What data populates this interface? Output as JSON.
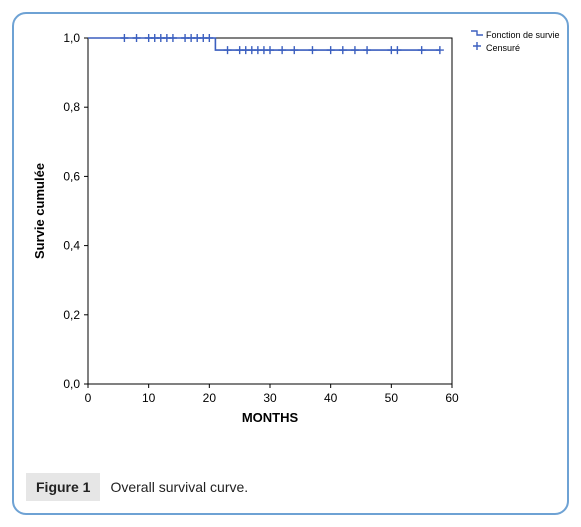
{
  "legend": {
    "series_label": "Fonction de survie",
    "censored_label": "Censuré"
  },
  "figure": {
    "badge": "Figure 1",
    "caption": "Overall survival curve."
  },
  "chart_data": {
    "type": "line",
    "title": "",
    "xlabel": "MONTHS",
    "ylabel": "Survie cumulée",
    "xlim": [
      0,
      60
    ],
    "ylim": [
      0.0,
      1.0
    ],
    "xticks": [
      0,
      10,
      20,
      30,
      40,
      50,
      60
    ],
    "yticks": [
      0.0,
      0.2,
      0.4,
      0.6,
      0.8,
      1.0
    ],
    "series": [
      {
        "name": "Fonction de survie",
        "type": "step",
        "points": [
          {
            "x": 0,
            "y": 1.0
          },
          {
            "x": 21,
            "y": 1.0
          },
          {
            "x": 21,
            "y": 0.965
          },
          {
            "x": 58,
            "y": 0.965
          }
        ],
        "censor_marks": [
          {
            "x": 6,
            "y": 1.0
          },
          {
            "x": 8,
            "y": 1.0
          },
          {
            "x": 10,
            "y": 1.0
          },
          {
            "x": 11,
            "y": 1.0
          },
          {
            "x": 12,
            "y": 1.0
          },
          {
            "x": 13,
            "y": 1.0
          },
          {
            "x": 14,
            "y": 1.0
          },
          {
            "x": 16,
            "y": 1.0
          },
          {
            "x": 17,
            "y": 1.0
          },
          {
            "x": 18,
            "y": 1.0
          },
          {
            "x": 19,
            "y": 1.0
          },
          {
            "x": 20,
            "y": 1.0
          },
          {
            "x": 23,
            "y": 0.965
          },
          {
            "x": 25,
            "y": 0.965
          },
          {
            "x": 26,
            "y": 0.965
          },
          {
            "x": 27,
            "y": 0.965
          },
          {
            "x": 28,
            "y": 0.965
          },
          {
            "x": 29,
            "y": 0.965
          },
          {
            "x": 30,
            "y": 0.965
          },
          {
            "x": 32,
            "y": 0.965
          },
          {
            "x": 34,
            "y": 0.965
          },
          {
            "x": 37,
            "y": 0.965
          },
          {
            "x": 40,
            "y": 0.965
          },
          {
            "x": 42,
            "y": 0.965
          },
          {
            "x": 44,
            "y": 0.965
          },
          {
            "x": 46,
            "y": 0.965
          },
          {
            "x": 50,
            "y": 0.965
          },
          {
            "x": 51,
            "y": 0.965
          },
          {
            "x": 55,
            "y": 0.965
          },
          {
            "x": 58,
            "y": 0.965
          }
        ]
      }
    ]
  }
}
